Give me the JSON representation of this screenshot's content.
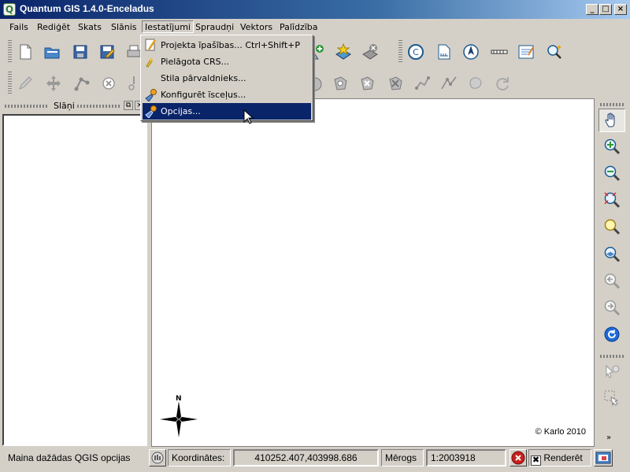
{
  "window": {
    "title": "Quantum GIS 1.4.0-Enceladus",
    "app_icon": "Q"
  },
  "window_controls": {
    "minimize": "_",
    "maximize": "□",
    "close": "×"
  },
  "menubar": {
    "items": [
      "Fails",
      "Rediģēt",
      "Skats",
      "Slānis",
      "Iestatījumi",
      "Spraudņi",
      "Vektors",
      "Palīdzība"
    ],
    "active": "Iestatījumi"
  },
  "settings_menu": {
    "items": [
      {
        "label": "Projekta īpašības...",
        "shortcut": "Ctrl+Shift+P",
        "icon": "project-properties-icon"
      },
      {
        "label": "Pielāgota CRS...",
        "shortcut": "",
        "icon": "custom-crs-icon"
      },
      {
        "label": "Stila pārvaldnieks...",
        "shortcut": "",
        "icon": ""
      },
      {
        "label": "Konfigurēt īsceļus...",
        "shortcut": "",
        "icon": "wrench-icon"
      },
      {
        "label": "Opcijas...",
        "shortcut": "",
        "icon": "wrench-icon",
        "highlighted": true
      }
    ]
  },
  "layers_panel": {
    "title": "Slāņi",
    "float_btn": "⧉",
    "close_btn": "×"
  },
  "map": {
    "copyright": "© Karlo 2010",
    "north_label": "N"
  },
  "statusbar": {
    "message": "Maina dažādas QGIS opcijas",
    "coords_label": "Koordinātes:",
    "coords_value": "410252.407,403998.686",
    "scale_label": "Mērogs",
    "scale_value": "1:2003918",
    "render_label": "Renderēt"
  },
  "colors": {
    "menu_highlight": "#0a246a",
    "window_bg": "#d4d0c8",
    "title_start": "#0a246a",
    "title_end": "#a6caf0"
  }
}
